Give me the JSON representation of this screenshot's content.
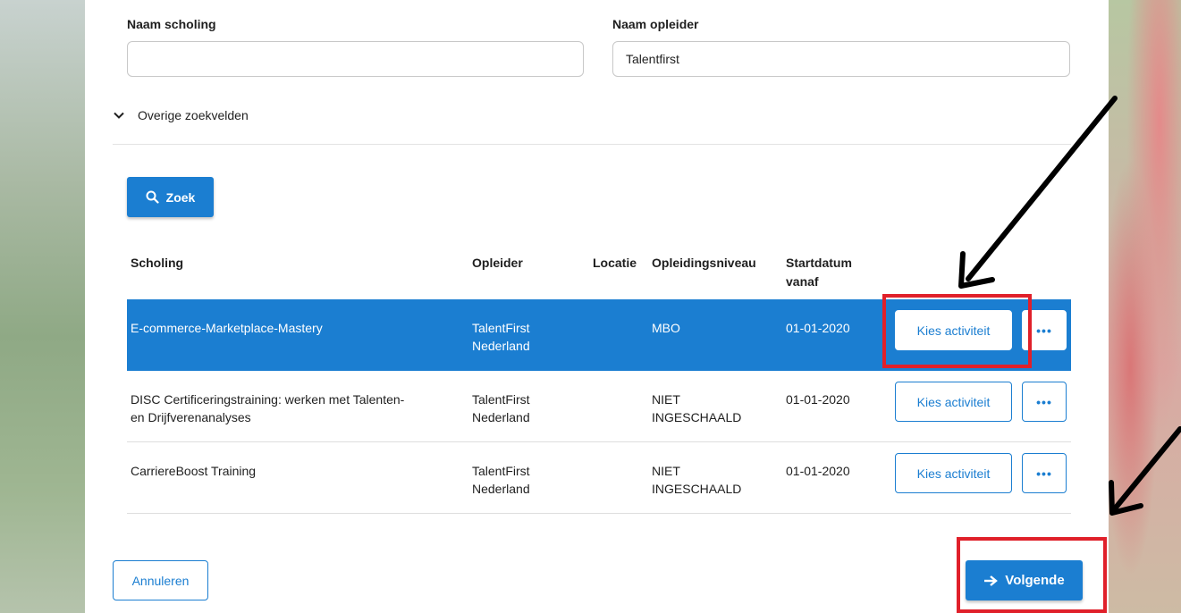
{
  "form": {
    "course_name_label": "Naam scholing",
    "course_name_value": "",
    "provider_label": "Naam opleider",
    "provider_value": "Talentfirst",
    "more_fields_label": "Overige zoekvelden",
    "search_button_label": "Zoek",
    "search_icon": "search-icon",
    "more_fields_icon": "chevron-down-icon"
  },
  "table": {
    "headers": {
      "scholing": "Scholing",
      "opleider": "Opleider",
      "locatie": "Locatie",
      "opleidingsniveau": "Opleidingsniveau",
      "startdatum_line1": "Startdatum",
      "startdatum_line2": "vanaf"
    },
    "rows": [
      {
        "scholing_line1": "E-commerce-Marketplace-Mastery",
        "scholing_line2": "",
        "opleider_line1": "TalentFirst",
        "opleider_line2": "Nederland",
        "locatie": "",
        "niveau_line1": "MBO",
        "niveau_line2": "",
        "startdatum": "01-01-2020",
        "action_label": "Kies activiteit",
        "more_label": "•••",
        "selected": true
      },
      {
        "scholing_line1": "DISC Certificeringstraining: werken met Talenten-",
        "scholing_line2": "en Drijfverenanalyses",
        "opleider_line1": "TalentFirst",
        "opleider_line2": "Nederland",
        "locatie": "",
        "niveau_line1": "NIET",
        "niveau_line2": "INGESCHAALD",
        "startdatum": "01-01-2020",
        "action_label": "Kies activiteit",
        "more_label": "•••",
        "selected": false
      },
      {
        "scholing_line1": "CarriereBoost Training",
        "scholing_line2": "",
        "opleider_line1": "TalentFirst",
        "opleider_line2": "Nederland",
        "locatie": "",
        "niveau_line1": "NIET",
        "niveau_line2": "INGESCHAALD",
        "startdatum": "01-01-2020",
        "action_label": "Kies activiteit",
        "more_label": "•••",
        "selected": false
      }
    ]
  },
  "footer": {
    "cancel_label": "Annuleren",
    "next_label": "Volgende",
    "next_icon": "arrow-right-icon"
  },
  "colors": {
    "primary": "#1b7ed1",
    "highlight": "#e0202a",
    "annotation": "#000000"
  }
}
